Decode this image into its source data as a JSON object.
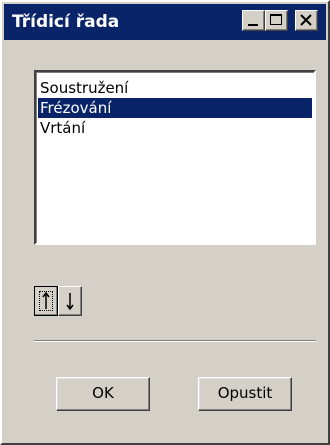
{
  "window": {
    "title": "Třídicí řada"
  },
  "list": {
    "items": [
      {
        "label": "Soustružení",
        "selected": false
      },
      {
        "label": "Frézování",
        "selected": true
      },
      {
        "label": "Vrtání",
        "selected": false
      }
    ]
  },
  "toolbar": {
    "move_up_icon": "arrow-up-icon",
    "move_down_icon": "arrow-down-icon"
  },
  "buttons": {
    "ok_label": "OK",
    "cancel_label": "Opustit"
  },
  "colors": {
    "selection": "#0a246a",
    "face": "#d4d0c8"
  }
}
